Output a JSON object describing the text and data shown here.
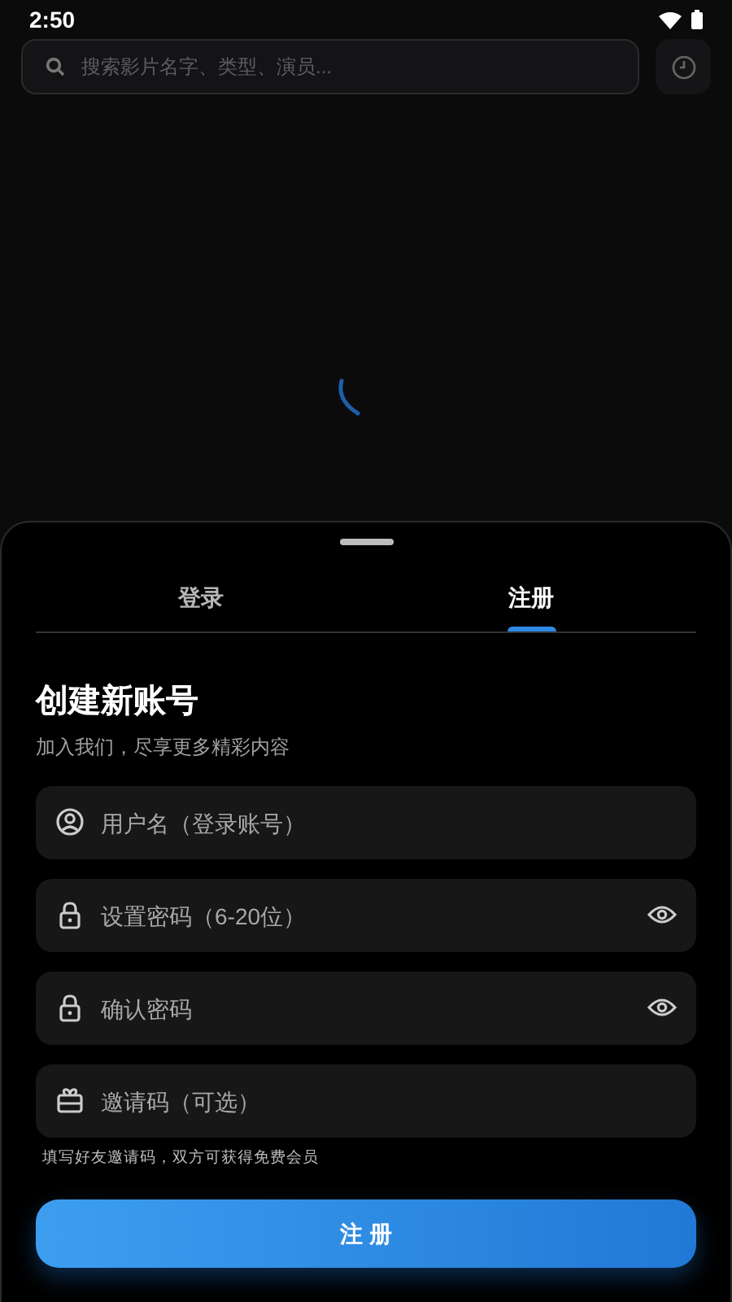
{
  "status_bar": {
    "time": "2:50"
  },
  "search": {
    "placeholder": "搜索影片名字、类型、演员..."
  },
  "sheet": {
    "tabs": [
      {
        "label": "登录",
        "selected": false
      },
      {
        "label": "注册",
        "selected": true
      }
    ],
    "title": "创建新账号",
    "subtitle": "加入我们，尽享更多精彩内容",
    "fields": [
      {
        "kind": "user",
        "placeholder": "用户名（登录账号）"
      },
      {
        "kind": "password",
        "placeholder": "设置密码（6-20位）"
      },
      {
        "kind": "password",
        "placeholder": "确认密码"
      },
      {
        "kind": "invite",
        "placeholder": "邀请码（可选）"
      }
    ],
    "hint": "填写好友邀请码，双方可获得免费会员",
    "submit": "注 册"
  }
}
